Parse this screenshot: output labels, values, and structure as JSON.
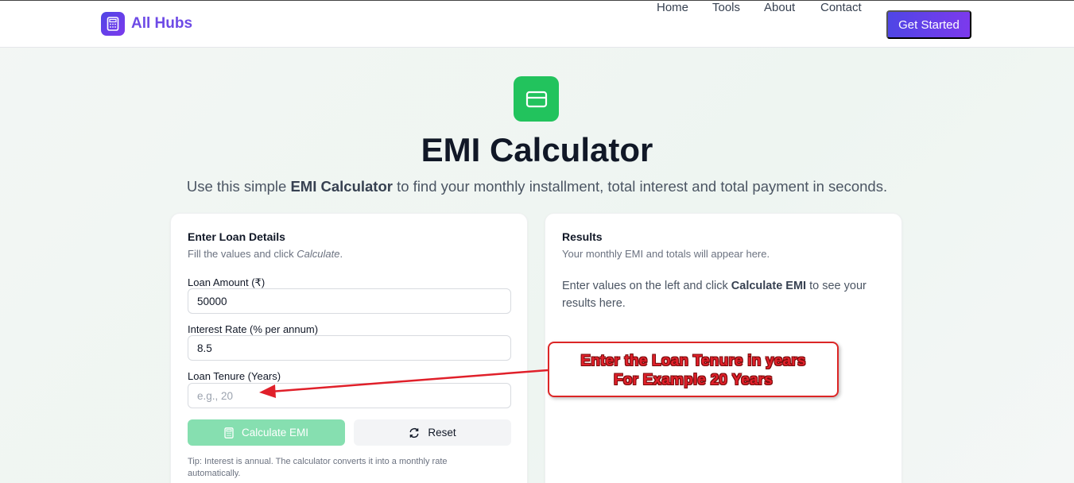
{
  "header": {
    "brand": "All Hubs",
    "nav": [
      "Home",
      "Tools",
      "About",
      "Contact"
    ],
    "cta_label": "Get Started"
  },
  "hero": {
    "title": "EMI Calculator",
    "subtitle_pre": "Use this simple ",
    "subtitle_bold": "EMI Calculator",
    "subtitle_post": " to find your monthly installment, total interest and total payment in seconds."
  },
  "form": {
    "title": "Enter Loan Details",
    "sub_pre": "Fill the values and click ",
    "sub_em": "Calculate",
    "sub_post": ".",
    "amount_label": "Loan Amount (₹)",
    "amount_value": "50000",
    "rate_label": "Interest Rate (% per annum)",
    "rate_value": "8.5",
    "tenure_label": "Loan Tenure (Years)",
    "tenure_value": "",
    "tenure_placeholder": "e.g., 20",
    "calc_label": "Calculate EMI",
    "reset_label": "Reset",
    "tip": "Tip: Interest is annual. The calculator converts it into a monthly rate automatically."
  },
  "results": {
    "title": "Results",
    "sub": "Your monthly EMI and totals will appear here.",
    "msg_pre": "Enter values on the left and click ",
    "msg_bold": "Calculate EMI",
    "msg_post": " to see your results here."
  },
  "annotation": {
    "line1": "Enter the Loan Tenure in years",
    "line2": "For Example 20 Years",
    "color": "#e0202a"
  },
  "icons": {
    "brand": "calculator-icon",
    "hero": "credit-card-icon",
    "calc_button": "calculator-icon",
    "reset_button": "refresh-icon"
  },
  "colors": {
    "brand_gradient_start": "#4f46e5",
    "brand_gradient_end": "#7c3aed",
    "accent_green": "#22c35d",
    "calc_button_bg": "#86dfb0"
  }
}
